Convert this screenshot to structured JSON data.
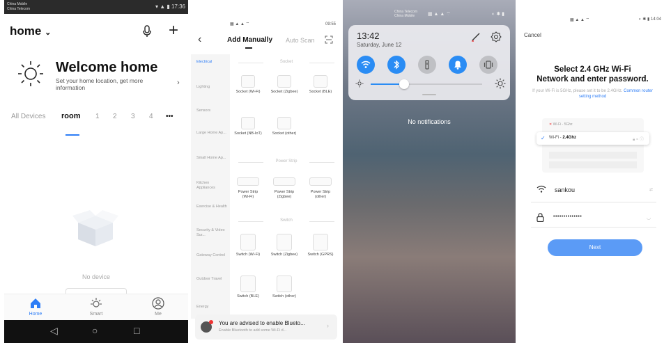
{
  "phone1": {
    "statusbar": {
      "carrier1": "China Mobile",
      "carrier2": "China Telecom",
      "time": "17:36"
    },
    "home_selector": "home",
    "welcome_title": "Welcome home",
    "welcome_sub": "Set your home location, get more information",
    "tabs": [
      "All Devices",
      "room",
      "1",
      "2",
      "3",
      "4"
    ],
    "tabs_more": "•••",
    "no_device": "No device",
    "nav": [
      {
        "label": "Home",
        "icon": "home-icon",
        "active": true
      },
      {
        "label": "Smart",
        "icon": "sun-icon",
        "active": false
      },
      {
        "label": "Me",
        "icon": "person-icon",
        "active": false
      }
    ]
  },
  "phone2": {
    "statusbar": {
      "time": "09:55"
    },
    "title": "Add Manually",
    "auto_scan": "Auto Scan",
    "categories": [
      {
        "label": "Electrical",
        "active": true
      },
      {
        "label": "Lighting",
        "active": false
      },
      {
        "label": "Sensors",
        "active": false
      },
      {
        "label": "Large Home Ap...",
        "active": false
      },
      {
        "label": "Small Home Ap...",
        "active": false
      },
      {
        "label": "Kitchen Appliances",
        "active": false
      },
      {
        "label": "Exercise & Health",
        "active": false
      },
      {
        "label": "Security & Video Sur...",
        "active": false
      },
      {
        "label": "Gateway Control",
        "active": false
      },
      {
        "label": "Outdoor Travel",
        "active": false
      },
      {
        "label": "Energy",
        "active": false
      }
    ],
    "sections": {
      "socket": "Socket",
      "power_strip": "Power Strip",
      "switch": "Switch"
    },
    "sockets": [
      "Socket (Wi-Fi)",
      "Socket (Zigbee)",
      "Socket (BLE)",
      "Socket (NB-IoT)",
      "Socket (other)"
    ],
    "strips": [
      "Power Strip (Wi-Fi)",
      "Power Strip (Zigbee)",
      "Power Strip (other)"
    ],
    "switches": [
      "Switch (Wi-Fi)",
      "Switch (Zigbee)",
      "Switch (GPRS)",
      "Switch (BLE)",
      "Switch (other)"
    ],
    "banner_title": "You are advised to enable Blueto...",
    "banner_sub": "Enable Bluetooth to add some Wi-Fi d..."
  },
  "phone3": {
    "statusbar": {
      "carrier1": "China Telecom",
      "carrier2": "China Mobile"
    },
    "time": "13:42",
    "date": "Saturday, June 12",
    "brightness": 0.3,
    "toggles": [
      {
        "icon": "wifi-icon",
        "on": true
      },
      {
        "icon": "bluetooth-icon",
        "on": true
      },
      {
        "icon": "flashlight-icon",
        "on": false
      },
      {
        "icon": "bell-icon",
        "on": true
      },
      {
        "icon": "vibrate-icon",
        "on": false
      }
    ],
    "no_notifications": "No notifications"
  },
  "phone4": {
    "statusbar": {
      "time": "14:04"
    },
    "cancel": "Cancel",
    "heading_line1": "Select 2.4 GHz Wi-Fi",
    "heading_line2": "Network and enter password.",
    "sub_text": "If your Wi-Fi is 5GHz, please set it to be 2.4GHz.",
    "sub_link": "Common router setting method",
    "wifi_5g_label": "Wi-Fi - 5Ghz",
    "wifi_24_prefix": "Wi-Fi - ",
    "wifi_24_bold": "2.4Ghz",
    "ssid": "sankou",
    "password_mask": "••••••••••••••",
    "next": "Next"
  },
  "colors": {
    "accent": "#2d7df6",
    "toggle_on": "#2a8cf4",
    "next_button": "#5b9bf6"
  }
}
